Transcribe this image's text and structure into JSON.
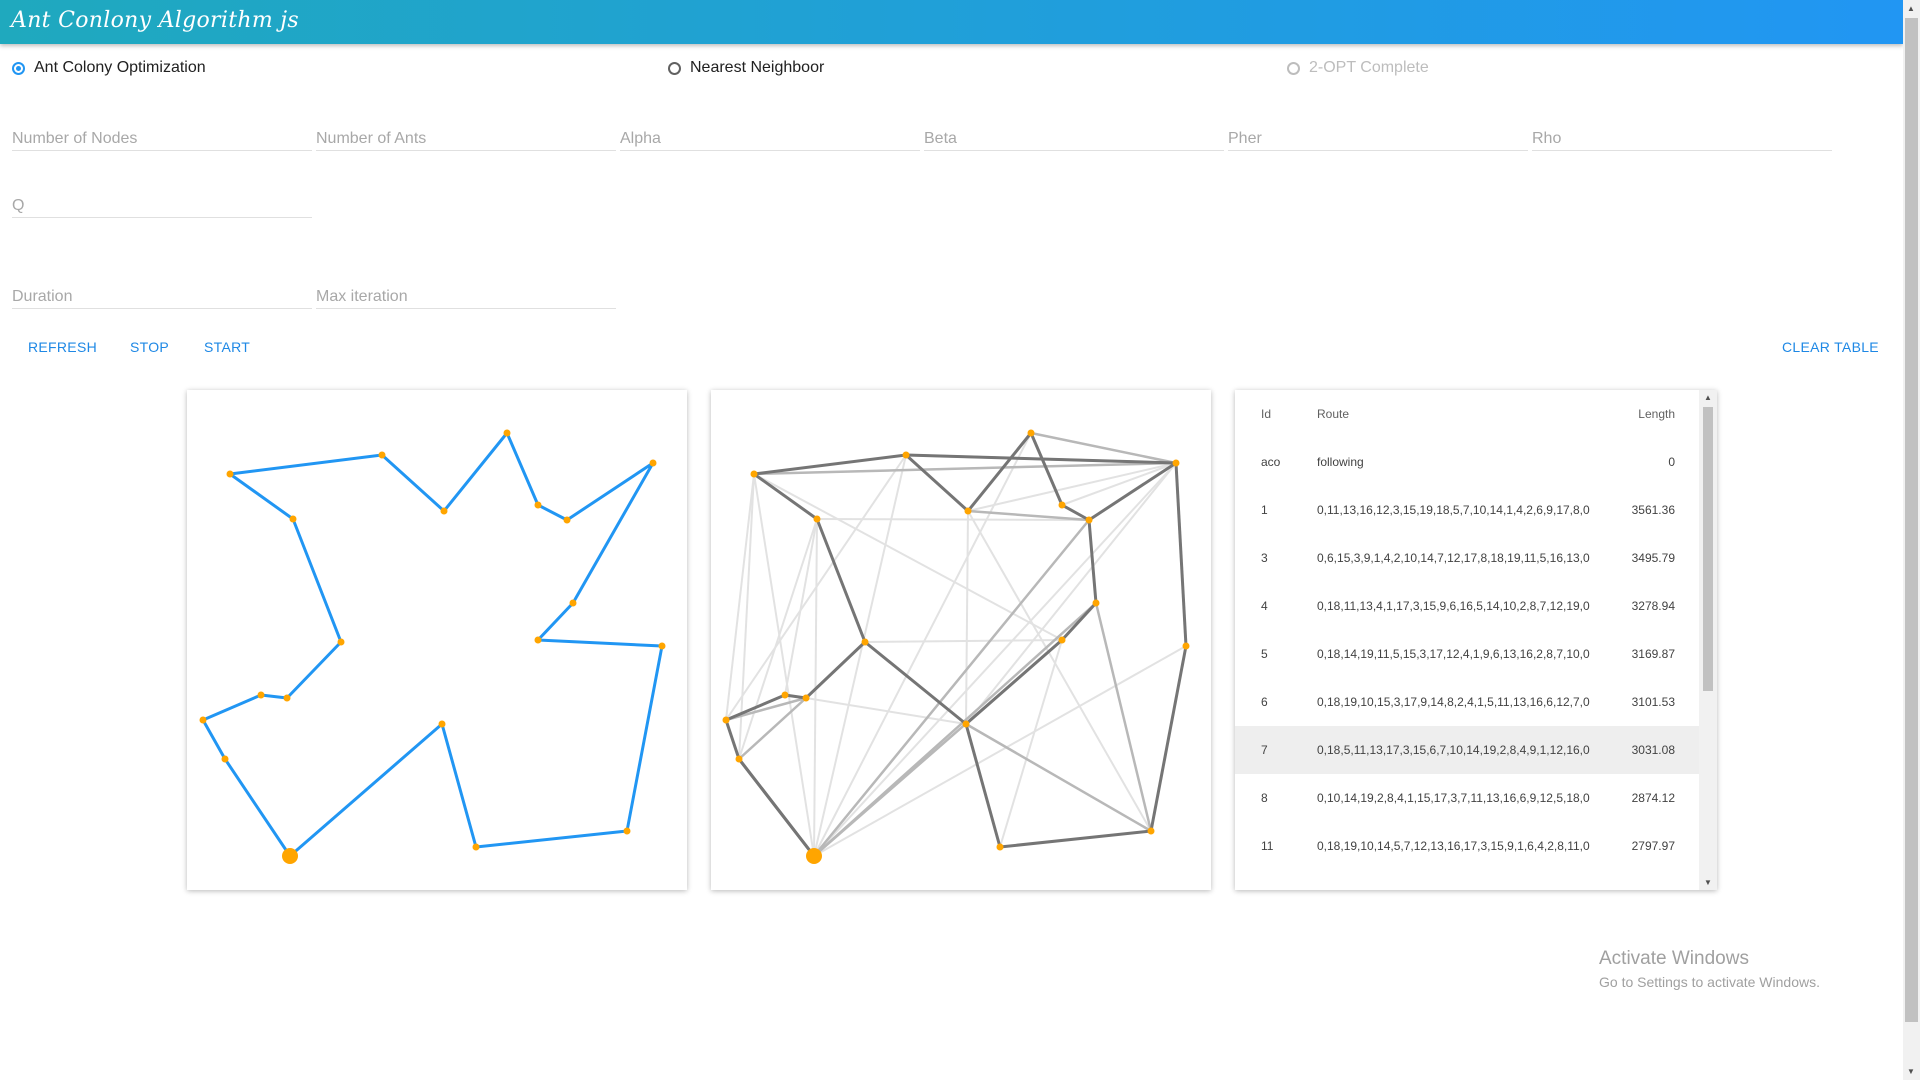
{
  "app": {
    "title": "Ant Conlony Algorithm js"
  },
  "algorithm_options": [
    {
      "label": "Ant Colony Optimization",
      "selected": true,
      "disabled": false
    },
    {
      "label": "Nearest Neighboor",
      "selected": false,
      "disabled": false
    },
    {
      "label": "2-OPT Complete",
      "selected": false,
      "disabled": true
    }
  ],
  "params": {
    "nodes": {
      "placeholder": "Number of Nodes",
      "value": ""
    },
    "ants": {
      "placeholder": "Number of Ants",
      "value": ""
    },
    "alpha": {
      "placeholder": "Alpha",
      "value": ""
    },
    "beta": {
      "placeholder": "Beta",
      "value": ""
    },
    "pher": {
      "placeholder": "Pher",
      "value": ""
    },
    "rho": {
      "placeholder": "Rho",
      "value": ""
    },
    "q": {
      "placeholder": "Q",
      "value": ""
    },
    "duration": {
      "placeholder": "Duration",
      "value": ""
    },
    "max_iteration": {
      "placeholder": "Max iteration",
      "value": ""
    }
  },
  "actions": {
    "refresh": "REFRESH",
    "stop": "STOP",
    "start": "START",
    "clear_table": "CLEAR TABLE"
  },
  "table": {
    "headers": {
      "id": "Id",
      "route": "Route",
      "length": "Length"
    },
    "rows": [
      {
        "id": "aco",
        "route": "following",
        "length": "0"
      },
      {
        "id": "1",
        "route": "0,11,13,16,12,3,15,19,18,5,7,10,14,1,4,2,6,9,17,8,0",
        "length": "3561.36"
      },
      {
        "id": "3",
        "route": "0,6,15,3,9,1,4,2,10,14,7,12,17,8,18,19,11,5,16,13,0",
        "length": "3495.79"
      },
      {
        "id": "4",
        "route": "0,18,11,13,4,1,17,3,15,9,6,16,5,14,10,2,8,7,12,19,0",
        "length": "3278.94"
      },
      {
        "id": "5",
        "route": "0,18,14,19,11,5,15,3,17,12,4,1,9,6,13,16,2,8,7,10,0",
        "length": "3169.87"
      },
      {
        "id": "6",
        "route": "0,18,19,10,15,3,17,9,14,8,2,4,1,5,11,13,16,6,12,7,0",
        "length": "3101.53"
      },
      {
        "id": "7",
        "route": "0,18,5,11,13,17,3,15,6,7,10,14,19,2,8,4,9,1,12,16,0",
        "length": "3031.08",
        "selected": true
      },
      {
        "id": "8",
        "route": "0,10,14,19,2,8,4,1,15,17,3,7,11,13,16,6,9,12,5,18,0",
        "length": "2874.12"
      },
      {
        "id": "11",
        "route": "0,18,19,10,14,5,7,12,13,16,17,3,15,9,1,6,4,2,8,11,0",
        "length": "2797.97"
      }
    ]
  },
  "colors": {
    "appbar_start": "#1fa9be",
    "appbar_end": "#2196f3",
    "accent": "#2196f3",
    "node": "#ffa500",
    "tour": "#2196f3"
  },
  "windows_watermark": {
    "line1": "Activate Windows",
    "line2": "Go to Settings to activate Windows."
  }
}
